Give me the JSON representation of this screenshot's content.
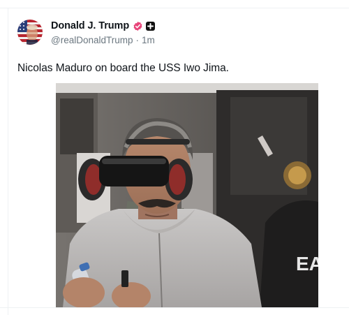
{
  "post": {
    "author": {
      "display_name": "Donald J. Trump",
      "handle": "@realDonaldTrump",
      "timestamp": "1m",
      "separator": "·",
      "verified_icon": "verified-badge-icon",
      "extra_badge_icon": "plus-square-icon"
    },
    "text": "Nicolas Maduro on board the USS Iwo Jima.",
    "media": {
      "kind": "photo",
      "shirt_lettering": "EA"
    }
  },
  "colors": {
    "text_primary": "#0f1419",
    "text_secondary": "#6b7780",
    "verified_pink": "#e8457a",
    "divider": "#eef1f3"
  }
}
